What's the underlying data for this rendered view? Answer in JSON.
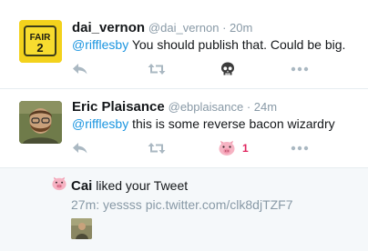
{
  "tweets": [
    {
      "name": "dai_vernon",
      "handle": "@dai_vernon",
      "separator": " · ",
      "time": "20m",
      "mention": "@rifflesby",
      "body": " You should publish that. Could be big.",
      "avatar_icon": "fair-2-sign-avatar",
      "actions": {
        "reply": "reply-icon",
        "retweet": "retweet-icon",
        "like": "skull-icon",
        "more": "more-icon"
      },
      "like_count": ""
    },
    {
      "name": "Eric Plaisance",
      "handle": "@ebplaisance",
      "separator": " · ",
      "time": "24m",
      "mention": "@rifflesby",
      "body": " this is some reverse bacon wizardry",
      "avatar_icon": "bearded-man-avatar",
      "actions": {
        "reply": "reply-icon",
        "retweet": "retweet-icon",
        "like": "pig-icon",
        "more": "more-icon"
      },
      "like_count": "1"
    }
  ],
  "notification": {
    "user": "Cai",
    "action": " liked your Tweet",
    "time": "27m:",
    "text": " yessss pic.twitter.com/clk8djTZF7",
    "icon": "pig-icon"
  },
  "colors": {
    "link": "#1b95e0",
    "muted": "#8899a6",
    "like_active": "#e0245e",
    "divider": "#e6ecf0",
    "notification_bg": "#f5f8fa"
  }
}
